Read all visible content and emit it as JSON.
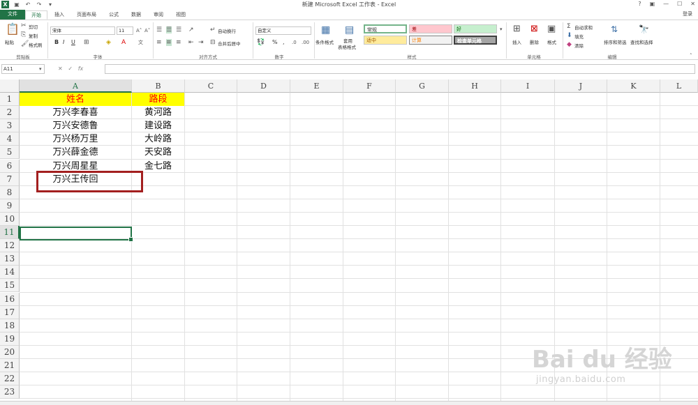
{
  "window": {
    "title": "新建 Microsoft Excel 工作表 - Excel",
    "controls": [
      "?",
      "▣",
      "—",
      "☐",
      "✕"
    ],
    "signin": "登录"
  },
  "tabs": [
    "文件",
    "开始",
    "插入",
    "页面布局",
    "公式",
    "数据",
    "审阅",
    "视图"
  ],
  "ribbon": {
    "clipboard": {
      "paste": "粘贴",
      "cut": "剪切",
      "copy": "复制",
      "format_painter": "格式刷",
      "label": "剪贴板"
    },
    "font": {
      "name": "宋体",
      "size": "11",
      "bold": "B",
      "italic": "I",
      "underline": "U",
      "label": "字体"
    },
    "alignment": {
      "wrap": "自动换行",
      "merge": "合并后居中",
      "label": "对齐方式"
    },
    "number": {
      "format": "自定义",
      "percent": "%",
      "comma": ",",
      "label": "数字"
    },
    "styles": {
      "conditional": "条件格式",
      "table": "套用\n表格格式",
      "normal": "常规",
      "bad": "差",
      "good": "好",
      "neutral": "适中",
      "calc": "计算",
      "check": "检查单元格",
      "label": "样式"
    },
    "cells": {
      "insert": "插入",
      "delete": "删除",
      "format": "格式",
      "label": "单元格"
    },
    "editing": {
      "autosum": "自动求和",
      "fill": "填充",
      "clear": "清除",
      "sort": "排序和筛选",
      "find": "查找和选择",
      "label": "编辑"
    }
  },
  "formula_bar": {
    "name_box": "A11",
    "fx": "fx",
    "value": ""
  },
  "sheet": {
    "columns": [
      "A",
      "B",
      "C",
      "D",
      "E",
      "F",
      "G",
      "H",
      "I",
      "J",
      "K",
      "L"
    ],
    "rows": [
      "1",
      "2",
      "3",
      "4",
      "5",
      "6",
      "7",
      "8",
      "9",
      "10",
      "11",
      "12",
      "13",
      "14",
      "15",
      "16",
      "17",
      "18",
      "19",
      "20",
      "21",
      "22",
      "23"
    ],
    "active_cell": "A11",
    "cells": {
      "A1": "姓名",
      "B1": "路段",
      "A2": "万兴李春喜",
      "B2": "黄河路",
      "A3": "万兴安德鲁",
      "B3": "建设路",
      "A4": "万兴杨万里",
      "B4": "大岭路",
      "A5": "万兴薛金德",
      "B5": "天安路",
      "A6": "万兴周星星",
      "B6": "金七路",
      "A7": "万兴王传回"
    }
  },
  "watermark": {
    "main": "Bai du 经验",
    "sub": "jingyan.baidu.com"
  },
  "colors": {
    "excel_green": "#217346",
    "header_fill": "#ffff00",
    "header_text": "#ff0000",
    "annotation": "#a31f1f"
  }
}
